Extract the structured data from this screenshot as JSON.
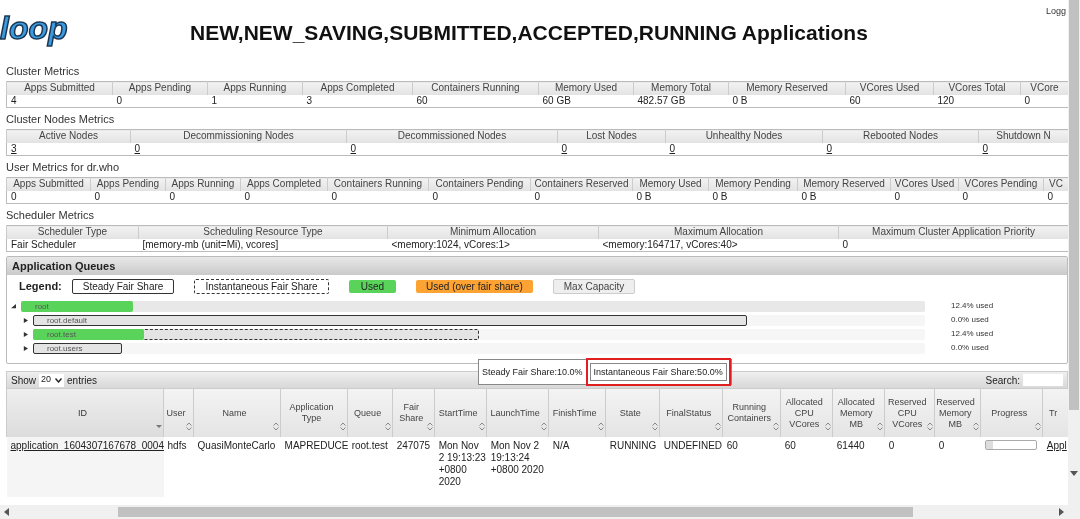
{
  "header": {
    "logo": "loop",
    "title": "NEW,NEW_SAVING,SUBMITTED,ACCEPTED,RUNNING Applications",
    "login": "Logg"
  },
  "metric_tables": [
    {
      "title": "Cluster Metrics",
      "columns": [
        "Apps Submitted",
        "Apps Pending",
        "Apps Running",
        "Apps Completed",
        "Containers Running",
        "Memory Used",
        "Memory Total",
        "Memory Reserved",
        "VCores Used",
        "VCores Total",
        "VCore"
      ],
      "values": [
        "4",
        "0",
        "1",
        "3",
        "60",
        "60 GB",
        "482.57 GB",
        "0 B",
        "60",
        "120",
        "0"
      ],
      "kind": "plain"
    },
    {
      "title": "Cluster Nodes Metrics",
      "columns": [
        "Active Nodes",
        "Decommissioning Nodes",
        "Decommissioned Nodes",
        "Lost Nodes",
        "Unhealthy Nodes",
        "Rebooted Nodes",
        "Shutdown N"
      ],
      "values": [
        "3",
        "0",
        "0",
        "0",
        "0",
        "0",
        "0"
      ],
      "kind": "links"
    },
    {
      "title": "User Metrics for dr.who",
      "columns": [
        "Apps Submitted",
        "Apps Pending",
        "Apps Running",
        "Apps Completed",
        "Containers Running",
        "Containers Pending",
        "Containers Reserved",
        "Memory Used",
        "Memory Pending",
        "Memory Reserved",
        "VCores Used",
        "VCores Pending",
        "VC"
      ],
      "values": [
        "0",
        "0",
        "0",
        "0",
        "0",
        "0",
        "0",
        "0 B",
        "0 B",
        "0 B",
        "0",
        "0",
        "0"
      ],
      "kind": "plain"
    },
    {
      "title": "Scheduler Metrics",
      "columns": [
        "Scheduler Type",
        "Scheduling Resource Type",
        "Minimum Allocation",
        "Maximum Allocation",
        "Maximum Cluster Application Priority"
      ],
      "values": [
        "Fair Scheduler",
        "[memory-mb (unit=Mi), vcores]",
        "<memory:1024, vCores:1>",
        "<memory:164717, vCores:40>",
        "0"
      ],
      "kind": "plain"
    }
  ],
  "queues_panel": {
    "title": "Application Queues",
    "legend_label": "Legend:",
    "legend": [
      {
        "kind": "steady",
        "label": "Steady Fair Share"
      },
      {
        "kind": "instantaneous",
        "label": "Instantaneous Fair Share"
      },
      {
        "kind": "used",
        "label": "Used"
      },
      {
        "kind": "over",
        "label": "Used (over fair share)"
      },
      {
        "kind": "max",
        "label": "Max Capacity"
      }
    ],
    "queues": [
      {
        "label": "root",
        "used_text": "12.4% used",
        "expanded": true,
        "used": {
          "level": 0.124
        },
        "children": [
          {
            "label": "root.default",
            "used_text": "0.0% used",
            "expanded": false,
            "steady_fair_share": {
              "level": 0.8
            }
          },
          {
            "label": "root.test",
            "used_text": "12.4% used",
            "expanded": false,
            "used": {
              "level": 0.124
            },
            "instantaneous_fair_share": {
              "level": 0.5
            }
          },
          {
            "label": "root.users",
            "used_text": "0.0% used",
            "expanded": false,
            "steady_fair_share": {
              "level": 0.1
            }
          }
        ]
      }
    ],
    "tooltip": [
      "Steady Fair Share:10.0%",
      "Instantaneous Fair Share:50.0%"
    ]
  },
  "apps": {
    "show_label": "Show",
    "page_size": "20",
    "entries_label": "entries",
    "search_label": "Search:",
    "columns": [
      {
        "label": "ID",
        "sorted": true
      },
      {
        "label": "User",
        "sorted": false
      },
      {
        "label": "Name",
        "sorted": false
      },
      {
        "label": "Application Type",
        "sorted": false
      },
      {
        "label": "Queue",
        "sorted": false
      },
      {
        "label": "Fair Share",
        "sorted": false
      },
      {
        "label": "StartTime",
        "sorted": false
      },
      {
        "label": "LaunchTime",
        "sorted": false
      },
      {
        "label": "FinishTime",
        "sorted": false
      },
      {
        "label": "State",
        "sorted": false
      },
      {
        "label": "FinalStatus",
        "sorted": false
      },
      {
        "label": "Running Containers",
        "sorted": false
      },
      {
        "label": "Allocated CPU VCores",
        "sorted": false
      },
      {
        "label": "Allocated Memory MB",
        "sorted": false
      },
      {
        "label": "Reserved CPU VCores",
        "sorted": false
      },
      {
        "label": "Reserved Memory MB",
        "sorted": false
      },
      {
        "label": "Progress",
        "sorted": false
      },
      {
        "label": "Tr"
      }
    ],
    "rows": [
      {
        "cells": [
          {
            "kind": "link",
            "text": "application_1604307167678_0004"
          },
          {
            "kind": "text",
            "text": "hdfs"
          },
          {
            "kind": "text",
            "text": "QuasiMonteCarlo"
          },
          {
            "kind": "text",
            "text": "MAPREDUCE"
          },
          {
            "kind": "text",
            "text": "root.test"
          },
          {
            "kind": "text",
            "text": "247075"
          },
          {
            "kind": "text",
            "text": "Mon Nov 2 19:13:23 +0800 2020"
          },
          {
            "kind": "text",
            "text": "Mon Nov 2 19:13:24 +0800 2020"
          },
          {
            "kind": "text",
            "text": "N/A"
          },
          {
            "kind": "text",
            "text": "RUNNING"
          },
          {
            "kind": "text",
            "text": "UNDEFINED"
          },
          {
            "kind": "text",
            "text": "60"
          },
          {
            "kind": "text",
            "text": "60"
          },
          {
            "kind": "text",
            "text": "61440"
          },
          {
            "kind": "text",
            "text": "0"
          },
          {
            "kind": "text",
            "text": "0"
          },
          {
            "kind": "progress",
            "level": 0.15
          },
          {
            "kind": "link",
            "text": "Appl"
          }
        ]
      }
    ]
  }
}
